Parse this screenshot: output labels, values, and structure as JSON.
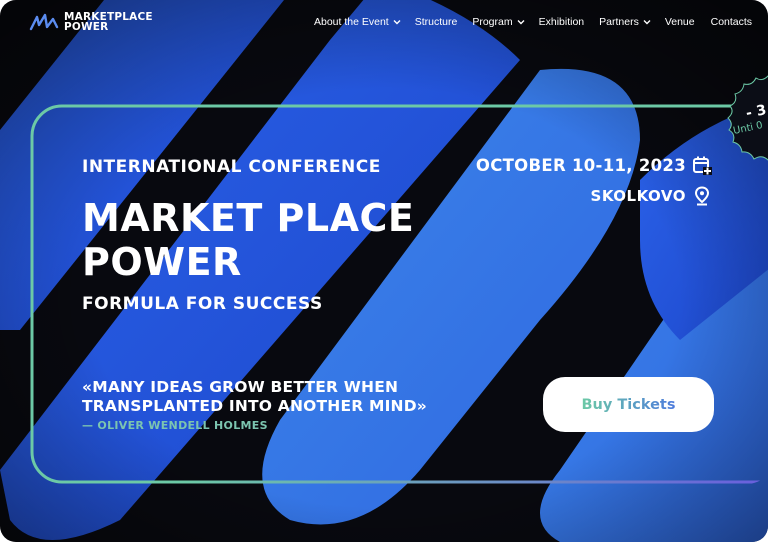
{
  "brand": {
    "line1": "MARKETPLACE",
    "line2": "POWER"
  },
  "nav": {
    "items": [
      {
        "label": "About the Event",
        "dropdown": true
      },
      {
        "label": "Structure",
        "dropdown": false
      },
      {
        "label": "Program",
        "dropdown": true
      },
      {
        "label": "Exhibition",
        "dropdown": false
      },
      {
        "label": "Partners",
        "dropdown": true
      },
      {
        "label": "Venue",
        "dropdown": false
      },
      {
        "label": "Contacts",
        "dropdown": false
      }
    ]
  },
  "hero": {
    "eyebrow": "INTERNATIONAL CONFERENCE",
    "title_line1": "MARKET PLACE",
    "title_line2": "POWER",
    "subtitle": "FORMULA FOR SUCCESS",
    "date": "OCTOBER 10-11, 2023",
    "venue": "SKOLKOVO",
    "quote_line1": "«MANY IDEAS GROW BETTER WHEN",
    "quote_line2": "TRANSPLANTED INTO ANOTHER MIND»",
    "quote_author": "— OLIVER WENDELL HOLMES",
    "cta_label": "Buy Tickets"
  },
  "badge": {
    "discount": "- 3",
    "until": "Unti 0"
  },
  "icons": {
    "calendar": "calendar-plus-icon",
    "location": "map-pin-icon",
    "chevron": "chevron-down-icon",
    "logo": "wave-logo-icon"
  },
  "colors": {
    "background": "#08090f",
    "accent_blue": "#2f6fe6",
    "accent_green": "#6cc9a6",
    "accent_purple": "#6a5ae0",
    "text": "#ffffff"
  }
}
